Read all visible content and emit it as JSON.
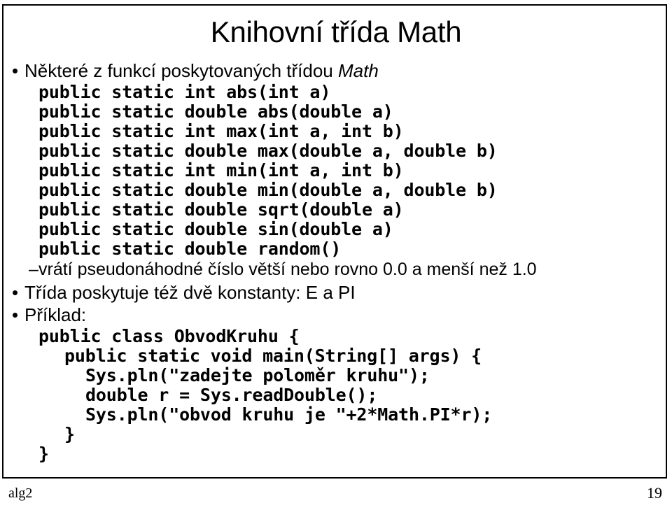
{
  "slide": {
    "title": "Knihovní třída Math",
    "page_number": "19",
    "footer_label": "alg2",
    "frame_color": "#000000",
    "background_color": "#ffffff",
    "text_color": "#000000"
  },
  "body": {
    "bullet_glyph": "•",
    "dash_glyph": "–",
    "blocks": [
      {
        "kind": "bullet1",
        "text_before": "Některé z funkcí poskytovaných třídou ",
        "emphasis": "Math",
        "text_after": ""
      },
      {
        "kind": "code",
        "indent": 0,
        "text": "public static int abs(int a)"
      },
      {
        "kind": "code",
        "indent": 0,
        "text": "public static double abs(double a)"
      },
      {
        "kind": "code",
        "indent": 0,
        "text": "public static int max(int a, int b)"
      },
      {
        "kind": "code",
        "indent": 0,
        "text": "public static double max(double a, double b)"
      },
      {
        "kind": "code",
        "indent": 0,
        "text": "public static int min(int a, int b)"
      },
      {
        "kind": "code",
        "indent": 0,
        "text": "public static double min(double a, double b)"
      },
      {
        "kind": "code",
        "indent": 0,
        "text": "public static double sqrt(double a)"
      },
      {
        "kind": "code",
        "indent": 0,
        "text": "public static double sin(double a)"
      },
      {
        "kind": "code",
        "indent": 0,
        "text": "public static double random()"
      },
      {
        "kind": "bullet2",
        "text": "vrátí pseudonáhodné číslo větší nebo rovno 0.0 a menší než 1.0"
      },
      {
        "kind": "bullet1",
        "text_before": "Třída poskytuje též dvě konstanty: E a PI",
        "emphasis": "",
        "text_after": ""
      },
      {
        "kind": "bullet1",
        "text_before": "Příklad:",
        "emphasis": "",
        "text_after": ""
      },
      {
        "kind": "code",
        "indent": 0,
        "text": "public class ObvodKruhu {"
      },
      {
        "kind": "code",
        "indent": 1,
        "text": "public static void main(String[] args) {"
      },
      {
        "kind": "code",
        "indent": 2,
        "text": "Sys.pln(\"zadejte poloměr kruhu\");"
      },
      {
        "kind": "code",
        "indent": 2,
        "text": "double r = Sys.readDouble();"
      },
      {
        "kind": "code",
        "indent": 2,
        "text": "Sys.pln(\"obvod kruhu je \"+2*Math.PI*r);"
      },
      {
        "kind": "code",
        "indent": 1,
        "text": "}"
      },
      {
        "kind": "code",
        "indent": 0,
        "text": "}"
      }
    ]
  }
}
